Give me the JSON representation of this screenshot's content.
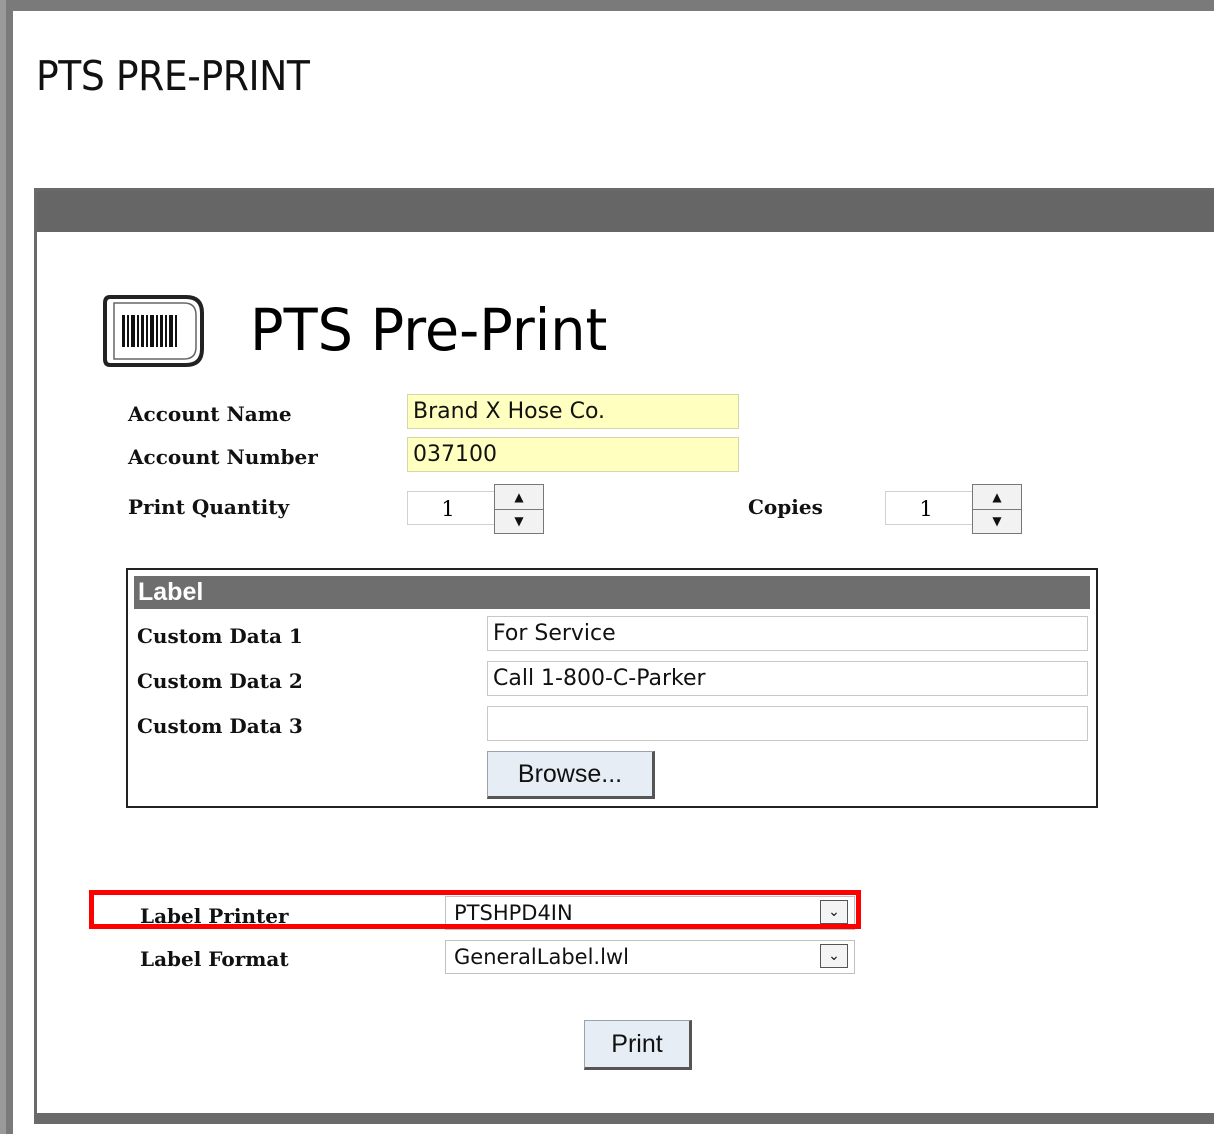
{
  "page": {
    "heading": "PTS PRE-PRINT"
  },
  "app": {
    "title": "PTS Pre-Print",
    "icon": "barcode-label-icon"
  },
  "account": {
    "name_label": "Account Name",
    "name_value": "Brand X Hose Co.",
    "number_label": "Account Number",
    "number_value": "037100"
  },
  "quantity": {
    "print_label": "Print Quantity",
    "print_value": "1",
    "copies_label": "Copies",
    "copies_value": "1",
    "up_glyph": "▲",
    "down_glyph": "▼"
  },
  "label_section": {
    "header": "Label",
    "fields": [
      {
        "label": "Custom Data 1",
        "value": "For Service"
      },
      {
        "label": "Custom Data 2",
        "value": "Call 1-800-C-Parker"
      },
      {
        "label": "Custom Data 3",
        "value": ""
      }
    ],
    "browse_label": "Browse..."
  },
  "printer": {
    "printer_label": "Label Printer",
    "printer_value": "PTSHPD4IN",
    "format_label": "Label Format",
    "format_value": "GeneralLabel.lwl",
    "dropdown_glyph": "⌄"
  },
  "actions": {
    "print_label": "Print"
  },
  "colors": {
    "panel_bar": "#666666",
    "required_field": "#ffffc0",
    "highlight": "#ff0000",
    "button_bg": "#e6edf4"
  }
}
